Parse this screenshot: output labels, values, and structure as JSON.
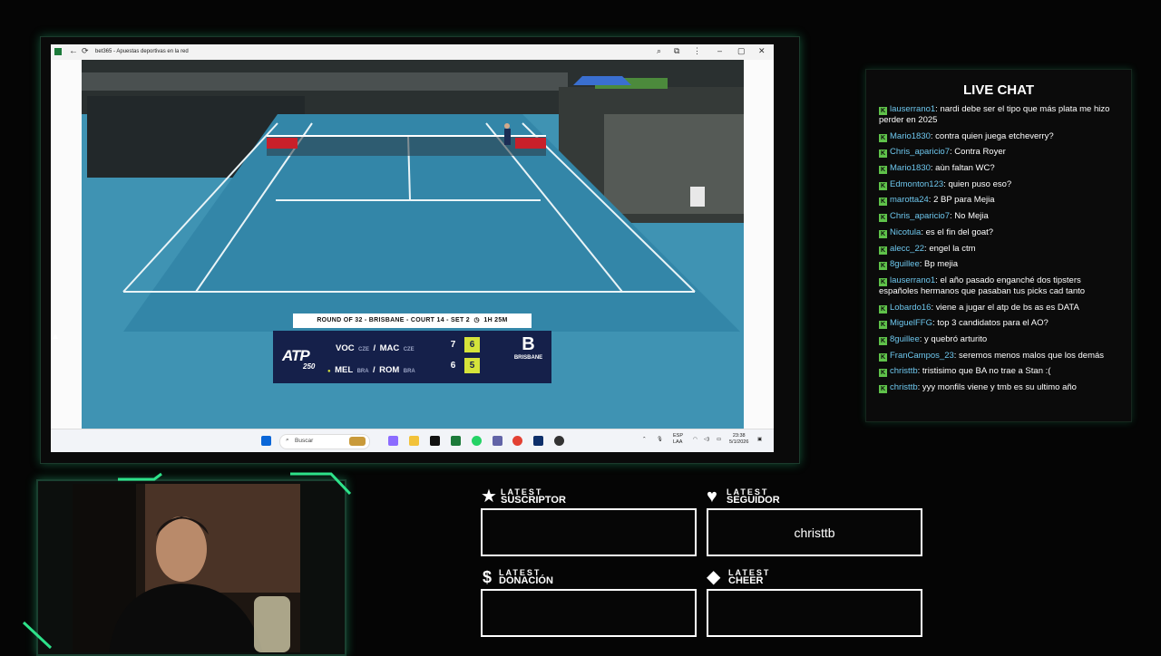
{
  "browser": {
    "title": "bet365 - Apuestas deportivas en la red",
    "minimize": "–",
    "maximize": "▢",
    "close": "✕"
  },
  "scoreboard": {
    "header": "ROUND OF 32 - BRISBANE - COURT 14 - SET 2",
    "time": "1H 25M",
    "tour_logo": "ATP",
    "tour_level": "250",
    "team1": {
      "p1": "VOC",
      "c1": "CZE",
      "sep": "/",
      "p2": "MAC",
      "c2": "CZE",
      "set1": "7",
      "set2": "6"
    },
    "team2": {
      "p1": "MEL",
      "c1": "BRA",
      "sep": "/",
      "p2": "ROM",
      "c2": "BRA",
      "set1": "6",
      "set2": "5"
    },
    "venue_logo": "BRISBANE"
  },
  "taskbar": {
    "search_placeholder": "Buscar",
    "lang": "ESP",
    "lang2": "LAA",
    "time": "23:38",
    "date": "5/1/2026"
  },
  "chat": {
    "title": "LIVE CHAT",
    "messages": [
      {
        "user": "lauserrano1",
        "text": "nardi debe ser el tipo que más plata me hizo perder en 2025"
      },
      {
        "user": "Mario1830",
        "text": "contra quien juega etcheverry?"
      },
      {
        "user": "Chris_aparicio7",
        "text": "Contra Royer"
      },
      {
        "user": "Mario1830",
        "text": "aùn faltan WC?"
      },
      {
        "user": "Edmonton123",
        "text": "quien puso eso?"
      },
      {
        "user": "marotta24",
        "text": "2 BP para Mejia"
      },
      {
        "user": "Chris_aparicio7",
        "text": "No Mejia"
      },
      {
        "user": "Nicotula",
        "text": "es el fin del goat?"
      },
      {
        "user": "alecc_22",
        "text": "engel la ctm"
      },
      {
        "user": "8guillee",
        "text": "Bp mejia"
      },
      {
        "user": "lauserrano1",
        "text": "el año pasado enganché dos tipsters españoles hermanos que pasaban tus picks cad tanto"
      },
      {
        "user": "Lobardo16",
        "text": "viene a jugar el atp de bs as es DATA"
      },
      {
        "user": "MiguelFFG",
        "text": "top 3 candidatos para el AO?"
      },
      {
        "user": "8guillee",
        "text": "y quebró arturito"
      },
      {
        "user": "FranCampos_23",
        "text": "seremos menos malos que los demás"
      },
      {
        "user": "christtb",
        "text": "tristisimo que BA no trae a Stan :("
      },
      {
        "user": "christtb",
        "text": "yyy monfils viene y tmb es su ultimo año"
      }
    ]
  },
  "alerts": {
    "subscriber": {
      "latest": "LATEST",
      "label": "SUSCRIPTOR",
      "value": ""
    },
    "follower": {
      "latest": "LATEST",
      "label": "SEGUIDOR",
      "value": "christtb"
    },
    "donation": {
      "latest": "LATEST",
      "label": "DONACIÓN",
      "value": ""
    },
    "cheer": {
      "latest": "LATEST",
      "label": "CHEER",
      "value": ""
    }
  },
  "colors": {
    "accent": "#2ee28a",
    "court": "#3a8fb0",
    "scoreboard": "#15204a",
    "highlight": "#d5e33a",
    "chat_user": "#6ec7ee"
  }
}
